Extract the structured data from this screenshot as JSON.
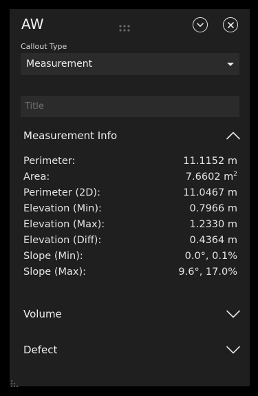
{
  "header": {
    "title": "AW",
    "collapse_icon": "chevron-down-circle-icon",
    "close_icon": "close-circle-icon",
    "drag_icon": "drag-handle-icon"
  },
  "callout": {
    "label": "Callout Type",
    "selected": "Measurement"
  },
  "title_field": {
    "value": "",
    "placeholder": "Title"
  },
  "sections": {
    "measurement": {
      "title": "Measurement Info",
      "expanded": true,
      "rows": [
        {
          "label": "Perimeter:",
          "value": "11.1152 m",
          "sup": ""
        },
        {
          "label": "Area:",
          "value": "7.6602 m",
          "sup": "2"
        },
        {
          "label": "Perimeter (2D):",
          "value": "11.0467 m",
          "sup": ""
        },
        {
          "label": "Elevation (Min):",
          "value": "0.7966 m",
          "sup": ""
        },
        {
          "label": "Elevation (Max):",
          "value": "1.2330 m",
          "sup": ""
        },
        {
          "label": "Elevation (Diff):",
          "value": "0.4364 m",
          "sup": ""
        },
        {
          "label": "Slope (Min):",
          "value": "0.0°, 0.1%",
          "sup": ""
        },
        {
          "label": "Slope (Max):",
          "value": "9.6°, 17.0%",
          "sup": ""
        }
      ]
    },
    "volume": {
      "title": "Volume",
      "expanded": false
    },
    "defect": {
      "title": "Defect",
      "expanded": false
    }
  },
  "colors": {
    "panel_bg": "#1f1f1f",
    "field_bg": "#2b2b2b",
    "text": "#e8e8e8",
    "placeholder": "#6f6f6f"
  }
}
